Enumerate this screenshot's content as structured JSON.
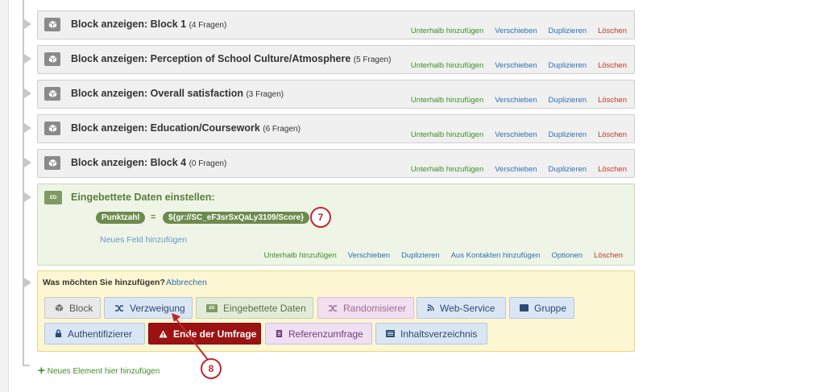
{
  "blocks": [
    {
      "title": "Block anzeigen: Block 1",
      "count": "(4 Fragen)"
    },
    {
      "title": "Block anzeigen: Perception of School Culture/Atmosphere",
      "count": "(5 Fragen)"
    },
    {
      "title": "Block anzeigen: Overall satisfaction",
      "count": "(3 Fragen)"
    },
    {
      "title": "Block anzeigen: Education/Coursework",
      "count": "(6 Fragen)"
    },
    {
      "title": "Block anzeigen: Block 4",
      "count": "(0 Fragen)"
    }
  ],
  "block_actions": {
    "add_below": "Unterhalb hinzufügen",
    "move": "Verschieben",
    "duplicate": "Duplizieren",
    "delete": "Löschen"
  },
  "embedded": {
    "icon_text": "ED",
    "title": "Eingebettete Daten einstellen:",
    "field_name": "Punktzahl",
    "equals": "=",
    "field_value": "${gr://SC_eF3srSxQaLy3109/Score}",
    "new_field": "Neues Feld hinzufügen",
    "actions": {
      "add_below": "Unterhalb hinzufügen",
      "move": "Verschieben",
      "duplicate": "Duplizieren",
      "from_contacts": "Aus Kontakten hinzufügen",
      "options": "Optionen",
      "delete": "Löschen"
    }
  },
  "callouts": {
    "seven": "7",
    "eight": "8"
  },
  "add_panel": {
    "question": "Was möchten Sie hinzufügen?",
    "cancel": "Abbrechen",
    "row1": [
      "Block",
      "Verzweigung",
      "Eingebettete Daten",
      "Randomisierer",
      "Web-Service",
      "Gruppe"
    ],
    "row2": [
      "Authentifizierer",
      "Ende der Umfrage",
      "Referenzumfrage",
      "Inhaltsverzeichnis"
    ],
    "ed_icon_text": "ED"
  },
  "new_element": "Neues Element hier hinzufügen",
  "colors": {
    "add_green": "#3e8e2a",
    "link_blue": "#2f6fb3",
    "delete_red": "#c0392b",
    "callout_red": "#c0272d",
    "end_survey_bg": "#9c1212"
  }
}
